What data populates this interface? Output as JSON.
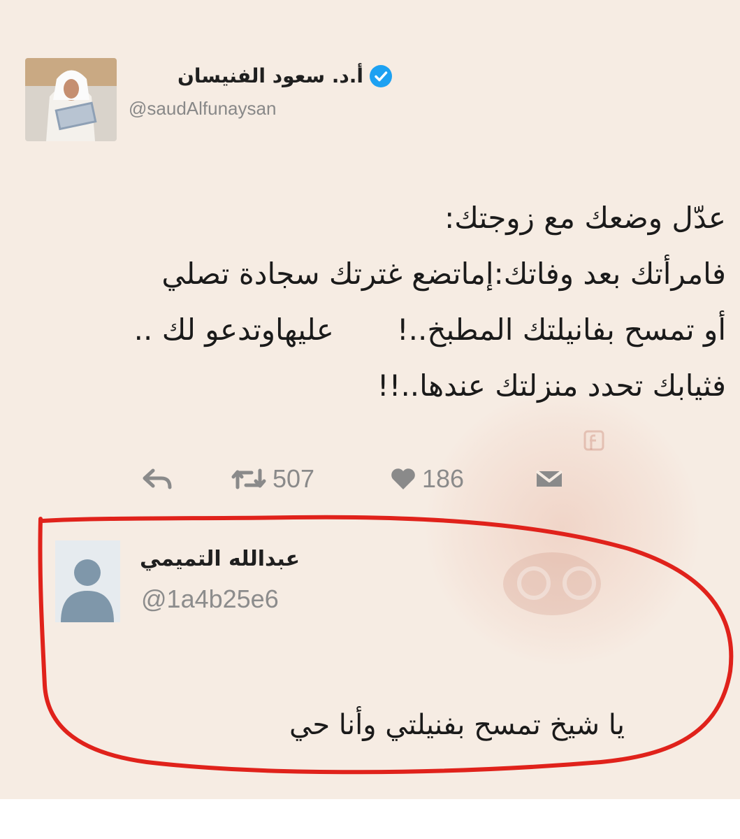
{
  "tweet": {
    "author_name": "أ.د. سعود الفنيسان",
    "handle": "@saudAlfunaysan",
    "verified": true,
    "lines": [
      "عدّل وضعك مع زوجتك:",
      "فامرأتك بعد وفاتك:إماتضع غترتك سجادة تصلي",
      "أو تمسح بفانيلتك المطبخ..!",
      "عليهاوتدعو لك ..",
      "فثيابك تحدد منزلتك عندها..!!"
    ],
    "actions": {
      "reply_icon": "reply-arrow-icon",
      "retweet_count": "507",
      "like_count": "186",
      "dm_icon": "envelope-icon"
    }
  },
  "reply": {
    "author_name": "عبدالله التميمي",
    "handle": "@1a4b25e6",
    "text": "يا شيخ تمسح بفنيلتي وأنا حي"
  },
  "watermark": {
    "icon": "facebook-icon"
  },
  "colors": {
    "background": "#f6ece3",
    "verified_blue": "#1da1f2",
    "annotation_red": "#e0221b",
    "muted_text": "#888888"
  }
}
